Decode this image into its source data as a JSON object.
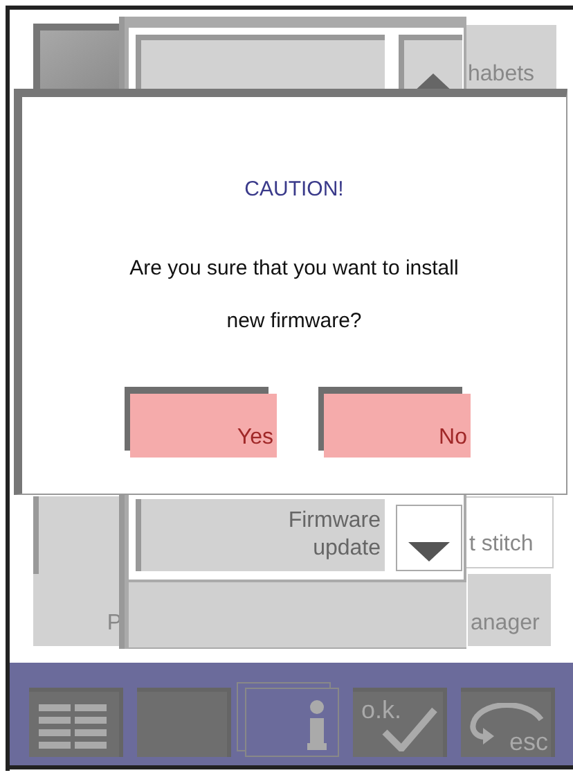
{
  "background": {
    "tiles": [
      {
        "text": "habets",
        "kind": "plain"
      },
      {
        "text": "t stitch",
        "kind": "outlined"
      },
      {
        "text": "P",
        "kind": "plain"
      },
      {
        "text": "anager",
        "kind": "plain"
      }
    ],
    "menu_item": {
      "label": "Firmware update"
    }
  },
  "dialog": {
    "title": "CAUTION!",
    "message": "Are you sure that you want to install new firmware?",
    "buttons": [
      "Yes",
      "No"
    ]
  },
  "toolbar": [
    {
      "kind": "menu",
      "selected": false
    },
    {
      "kind": "blank",
      "selected": false
    },
    {
      "kind": "info",
      "selected": true
    },
    {
      "kind": "ok",
      "label": "o.k.",
      "selected": false
    },
    {
      "kind": "esc",
      "label": "esc",
      "selected": false
    }
  ]
}
